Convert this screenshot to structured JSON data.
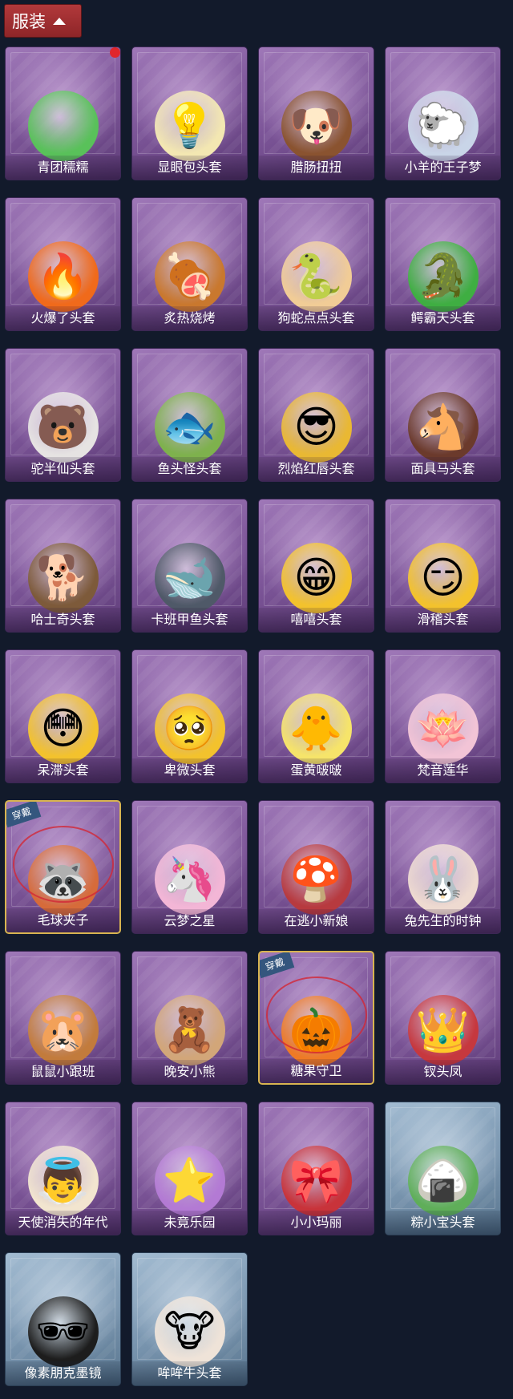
{
  "header": {
    "label": "服装"
  },
  "colors": {
    "header_bg": "#a92f31",
    "card_purple": "#8b63a8",
    "card_blue": "#7f9bb5",
    "equipped_border": "#d8b450",
    "new_dot": "#e0262b"
  },
  "items": [
    {
      "label": "青团糯糯",
      "icon": "green-dumpling-head-icon",
      "glyph": "●",
      "color": "#59c15a",
      "new": true
    },
    {
      "label": "显眼包头套",
      "icon": "lightbulb-head-icon",
      "glyph": "💡",
      "color": "#f3e7b2"
    },
    {
      "label": "腊肠扭扭",
      "icon": "dachshund-head-icon",
      "glyph": "🐶",
      "color": "#8a5330"
    },
    {
      "label": "小羊的王子梦",
      "icon": "crowned-sheep-head-icon",
      "glyph": "🐑",
      "color": "#c9d5e8"
    },
    {
      "label": "火爆了头套",
      "icon": "fire-head-icon",
      "glyph": "🔥",
      "color": "#f06a1b"
    },
    {
      "label": "炙热烧烤",
      "icon": "bbq-meat-head-icon",
      "glyph": "🍖",
      "color": "#c9782e"
    },
    {
      "label": "狗蛇点点头套",
      "icon": "snake-head-icon",
      "glyph": "🐍",
      "color": "#f1cc96"
    },
    {
      "label": "鳄霸天头套",
      "icon": "crocodile-head-icon",
      "glyph": "🐊",
      "color": "#3fae42"
    },
    {
      "label": "驼半仙头套",
      "icon": "alpaca-sunglasses-head-icon",
      "glyph": "🐻",
      "color": "#e6e3e2"
    },
    {
      "label": "鱼头怪头套",
      "icon": "fish-head-icon",
      "glyph": "🐟",
      "color": "#7eb14d"
    },
    {
      "label": "烈焰红唇头套",
      "icon": "yellow-mask-head-icon",
      "glyph": "😎",
      "color": "#e9b833"
    },
    {
      "label": "面具马头套",
      "icon": "horse-head-icon",
      "glyph": "🐴",
      "color": "#6b3a2c"
    },
    {
      "label": "哈士奇头套",
      "icon": "husky-sunglasses-head-icon",
      "glyph": "🐕",
      "color": "#7d5a3a"
    },
    {
      "label": "卡班甲鱼头套",
      "icon": "whale-head-icon",
      "glyph": "🐋",
      "color": "#4f5968"
    },
    {
      "label": "嘻嘻头套",
      "icon": "grin-emoji-head-icon",
      "glyph": "😁",
      "color": "#f3c22d"
    },
    {
      "label": "滑稽头套",
      "icon": "smirk-emoji-head-icon",
      "glyph": "😏",
      "color": "#f3c22d"
    },
    {
      "label": "呆滞头套",
      "icon": "blank-emoji-head-icon",
      "glyph": "😳",
      "color": "#f3c22d"
    },
    {
      "label": "卑微头套",
      "icon": "humble-emoji-head-icon",
      "glyph": "🥺",
      "color": "#f3c22d"
    },
    {
      "label": "蛋黄啵啵",
      "icon": "egg-chick-head-icon",
      "glyph": "🐥",
      "color": "#f6e46a"
    },
    {
      "label": "梵音莲华",
      "icon": "lotus-doll-charm-icon",
      "glyph": "🪷",
      "color": "#f2c4d6"
    },
    {
      "label": "毛球夹子",
      "icon": "raccoon-charm-icon",
      "glyph": "🦝",
      "color": "#d66b3a",
      "equipped": true,
      "badge": "穿戴"
    },
    {
      "label": "云梦之星",
      "icon": "unicorn-charm-icon",
      "glyph": "🦄",
      "color": "#f3b6d6"
    },
    {
      "label": "在逃小新娘",
      "icon": "mushroom-bride-charm-icon",
      "glyph": "🍄",
      "color": "#b73a3f"
    },
    {
      "label": "兔先生的时钟",
      "icon": "rabbit-clock-charm-icon",
      "glyph": "🐰",
      "color": "#eedad0"
    },
    {
      "label": "鼠鼠小跟班",
      "icon": "hamster-charm-icon",
      "glyph": "🐹",
      "color": "#c27b3c"
    },
    {
      "label": "晚安小熊",
      "icon": "teddy-bear-charm-icon",
      "glyph": "🧸",
      "color": "#d2a679"
    },
    {
      "label": "糖果守卫",
      "icon": "pumpkin-guard-charm-icon",
      "glyph": "🎃",
      "color": "#ee7a25",
      "equipped": true,
      "badge": "穿戴"
    },
    {
      "label": "钗头凤",
      "icon": "phoenix-crown-doll-charm-icon",
      "glyph": "👑",
      "color": "#c6383e"
    },
    {
      "label": "天使消失的年代",
      "icon": "angel-doll-charm-icon",
      "glyph": "👼",
      "color": "#f2e5cf"
    },
    {
      "label": "未竟乐园",
      "icon": "wonderland-doll-charm-icon",
      "glyph": "⭐",
      "color": "#b37ad4"
    },
    {
      "label": "小小玛丽",
      "icon": "mary-doll-charm-icon",
      "glyph": "🎀",
      "color": "#c8333a"
    },
    {
      "label": "粽小宝头套",
      "icon": "zongzi-head-icon",
      "glyph": "🍙",
      "color": "#5fae59",
      "blue": true
    },
    {
      "label": "像素朋克墨镜",
      "icon": "pixel-sunglasses-icon",
      "glyph": "🕶",
      "color": "#1d1d1d",
      "blue": true
    },
    {
      "label": "哞哞牛头套",
      "icon": "cow-head-icon",
      "glyph": "🐮",
      "color": "#efe3d8",
      "blue": true
    }
  ]
}
